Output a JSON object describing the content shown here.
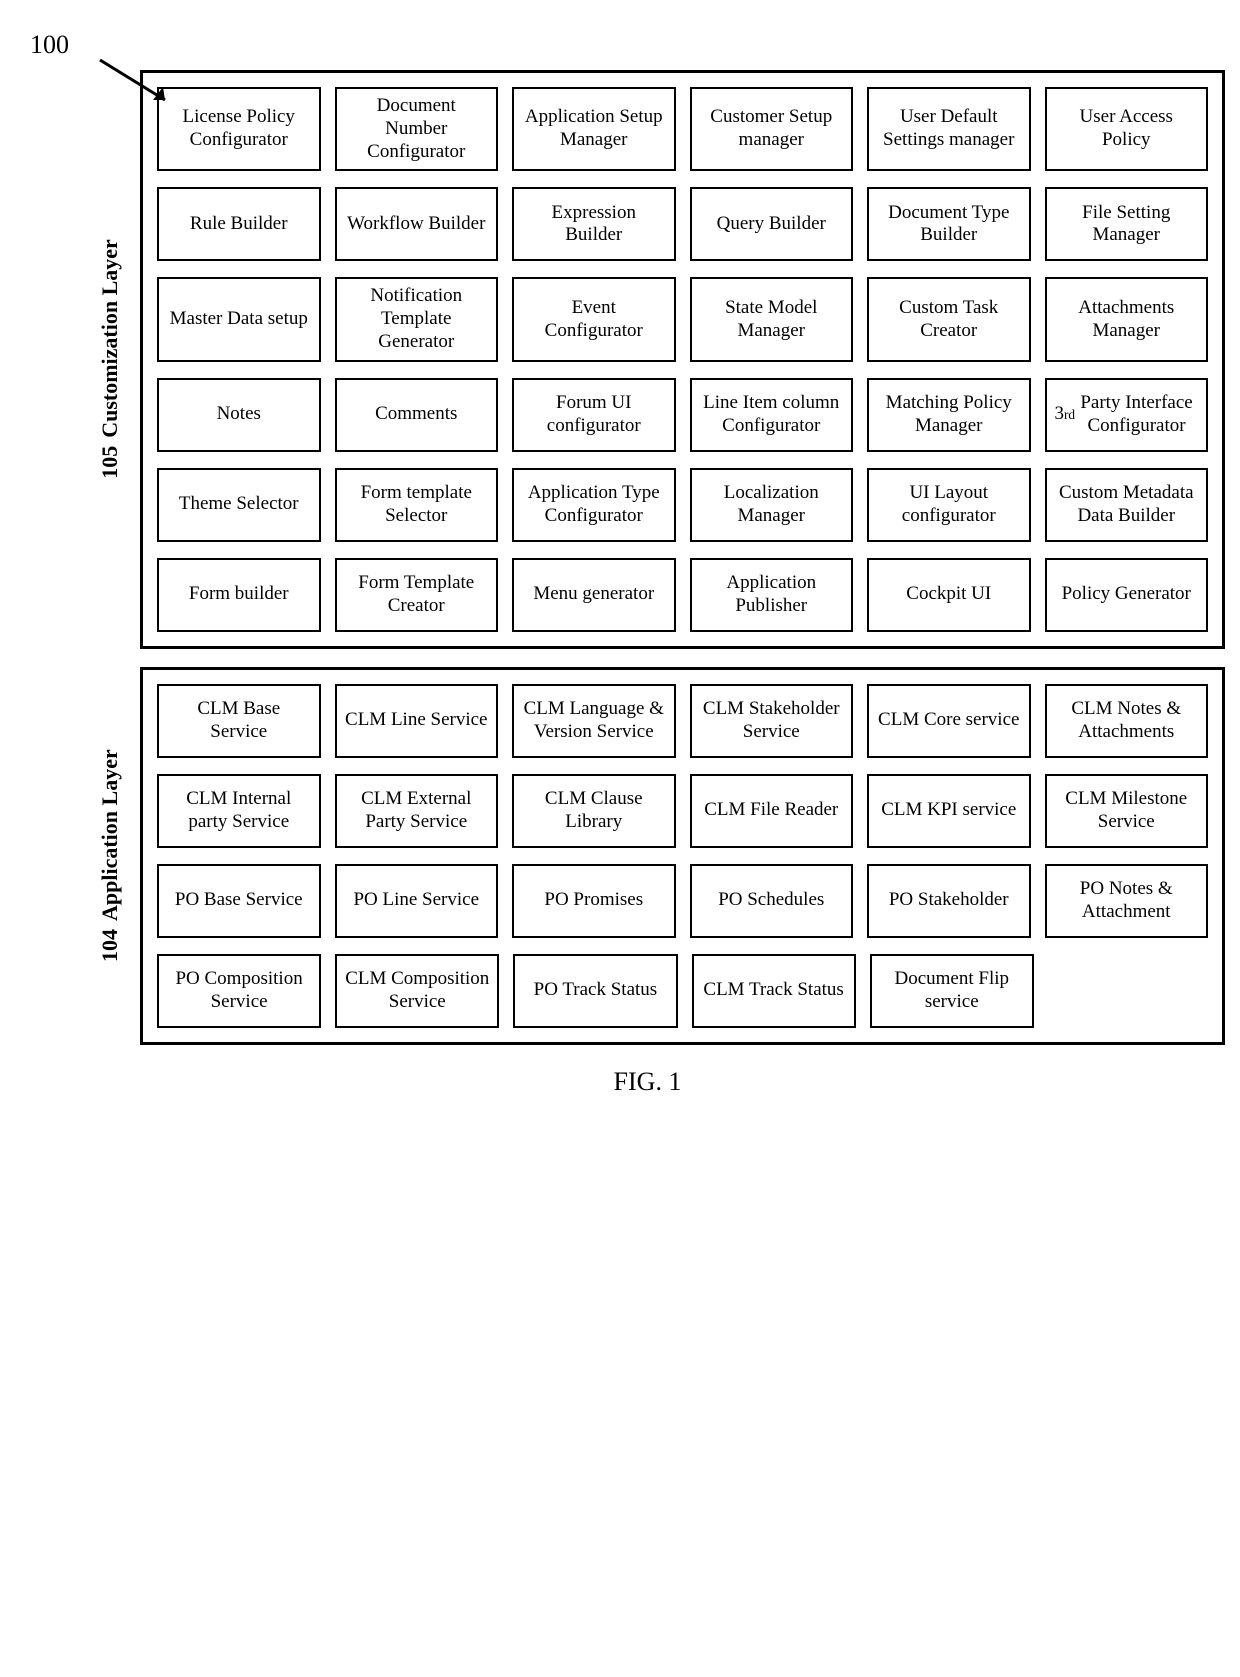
{
  "figure_ref": "100",
  "caption": "FIG. 1",
  "layers": [
    {
      "id": "105",
      "title": "Customization Layer",
      "rows": [
        [
          "License Policy Configurator",
          "Document Number Configurator",
          "Application Setup Manager",
          "Customer Setup manager",
          "User Default Settings manager",
          "User Access Policy"
        ],
        [
          "Rule Builder",
          "Workflow Builder",
          "Expression Builder",
          "Query Builder",
          "Document Type Builder",
          "File Setting Manager"
        ],
        [
          "Master Data setup",
          "Notification Template Generator",
          "Event Configurator",
          "State Model Manager",
          "Custom Task Creator",
          "Attachments Manager"
        ],
        [
          "Notes",
          "Comments",
          "Forum UI configurator",
          "Line Item column Configurator",
          "Matching Policy Manager",
          "3rd Party Interface Configurator"
        ],
        [
          "Theme Selector",
          "Form template Selector",
          "Application Type Configurator",
          "Localization Manager",
          "UI Layout configurator",
          "Custom Metadata Data Builder"
        ],
        [
          "Form builder",
          "Form Template Creator",
          "Menu generator",
          "Application Publisher",
          "Cockpit UI",
          "Policy Generator"
        ]
      ]
    },
    {
      "id": "104",
      "title": "Application Layer",
      "rows": [
        [
          "CLM Base Service",
          "CLM Line Service",
          "CLM Language & Version Service",
          "CLM Stakeholder Service",
          "CLM Core service",
          "CLM Notes & Attachments"
        ],
        [
          "CLM Internal party Service",
          "CLM External Party Service",
          "CLM Clause Library",
          "CLM File Reader",
          "CLM KPI service",
          "CLM Milestone Service"
        ],
        [
          "PO Base Service",
          "PO Line Service",
          "PO Promises",
          "PO Schedules",
          "PO Stakeholder",
          "PO Notes & Attachment"
        ],
        [
          "PO Composition Service",
          "CLM Composition Service",
          "PO Track Status",
          "CLM Track Status",
          "Document Flip service",
          ""
        ]
      ]
    }
  ]
}
